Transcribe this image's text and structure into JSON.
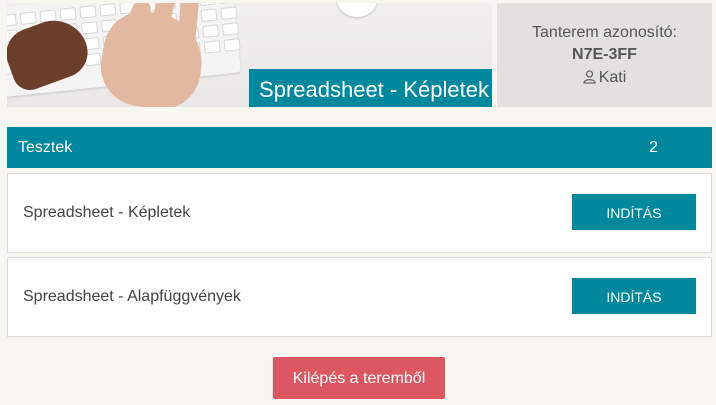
{
  "banner": {
    "title": "Spreadsheet - Képletek"
  },
  "room": {
    "label": "Tanterem azonosító:",
    "code": "N7E-3FF",
    "user_icon": "user-icon",
    "user_name": "Kati"
  },
  "tests": {
    "title": "Tesztek",
    "count": "2",
    "items": [
      {
        "label": "Spreadsheet - Képletek",
        "button_label": "INDÍTÁS"
      },
      {
        "label": "Spreadsheet - Alapfüggvények",
        "button_label": "INDÍTÁS"
      }
    ]
  },
  "exit_button_label": "Kilépés a teremből",
  "colors": {
    "accent": "#00889e",
    "exit": "#dc5761",
    "background": "#f7f6f1",
    "room_box": "#e2e1de"
  }
}
